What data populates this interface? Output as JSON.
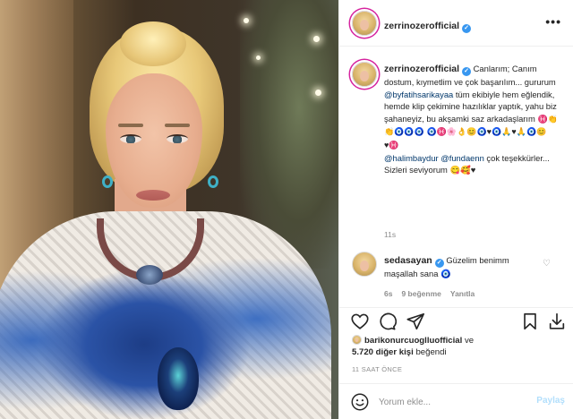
{
  "post_author": {
    "username": "zerrinozerofficial",
    "verified": true,
    "more_icon": "ellipsis-icon"
  },
  "caption": {
    "username": "zerrinozerofficial",
    "lines": [
      "Canlarım;",
      "Canım dostum, kıymetlim ve çok başarılım... gururum ",
      "@byfatihsarikayaa",
      " tüm ekibiyle hem eğlendik, hemde klip çekimine hazılıklar yaptık, yahu biz şahaneyiz, bu akşamki saz arkadaşlarım "
    ],
    "emoji_line_1": "♓👏👏🧿🧿🧿",
    "emoji_line_2": "🧿♓🌸👌😊🧿♥🧿🙏♥🙏🧿😊",
    "emoji_line_3": "♥♓",
    "mention_1": "@halimbaydur",
    "mention_2": "@fundaenn",
    "after_mentions": " çok teşekkürler...",
    "closing": "Sizleri seviyorum 😋🥰♥",
    "age": "11s"
  },
  "comment": {
    "username": "sedasayan",
    "verified": true,
    "text": "Güzelim benimm maşallah sana 🧿",
    "age": "6s",
    "likes": "9 beğenme",
    "reply": "Yanıtla"
  },
  "actions": {
    "like_icon": "heart-icon",
    "comment_icon": "comment-icon",
    "share_icon": "paper-plane-icon",
    "save_icon": "bookmark-icon",
    "download_icon": "download-icon"
  },
  "likes": {
    "liker": "barikonurcuoglluofficial",
    "connector": " ve",
    "others": "5.720 diğer kişi",
    "suffix": " beğendi"
  },
  "timestamp": "11 SAAT ÖNCE",
  "composer": {
    "emoji_icon": "smiley-icon",
    "placeholder": "Yorum ekle...",
    "post_label": "Paylaş"
  },
  "colors": {
    "verified": "#3897f0",
    "mention": "#00376b",
    "secondary_text": "#8e8e8e",
    "post_button_disabled": "#b2dffc",
    "divider": "#efefef"
  }
}
